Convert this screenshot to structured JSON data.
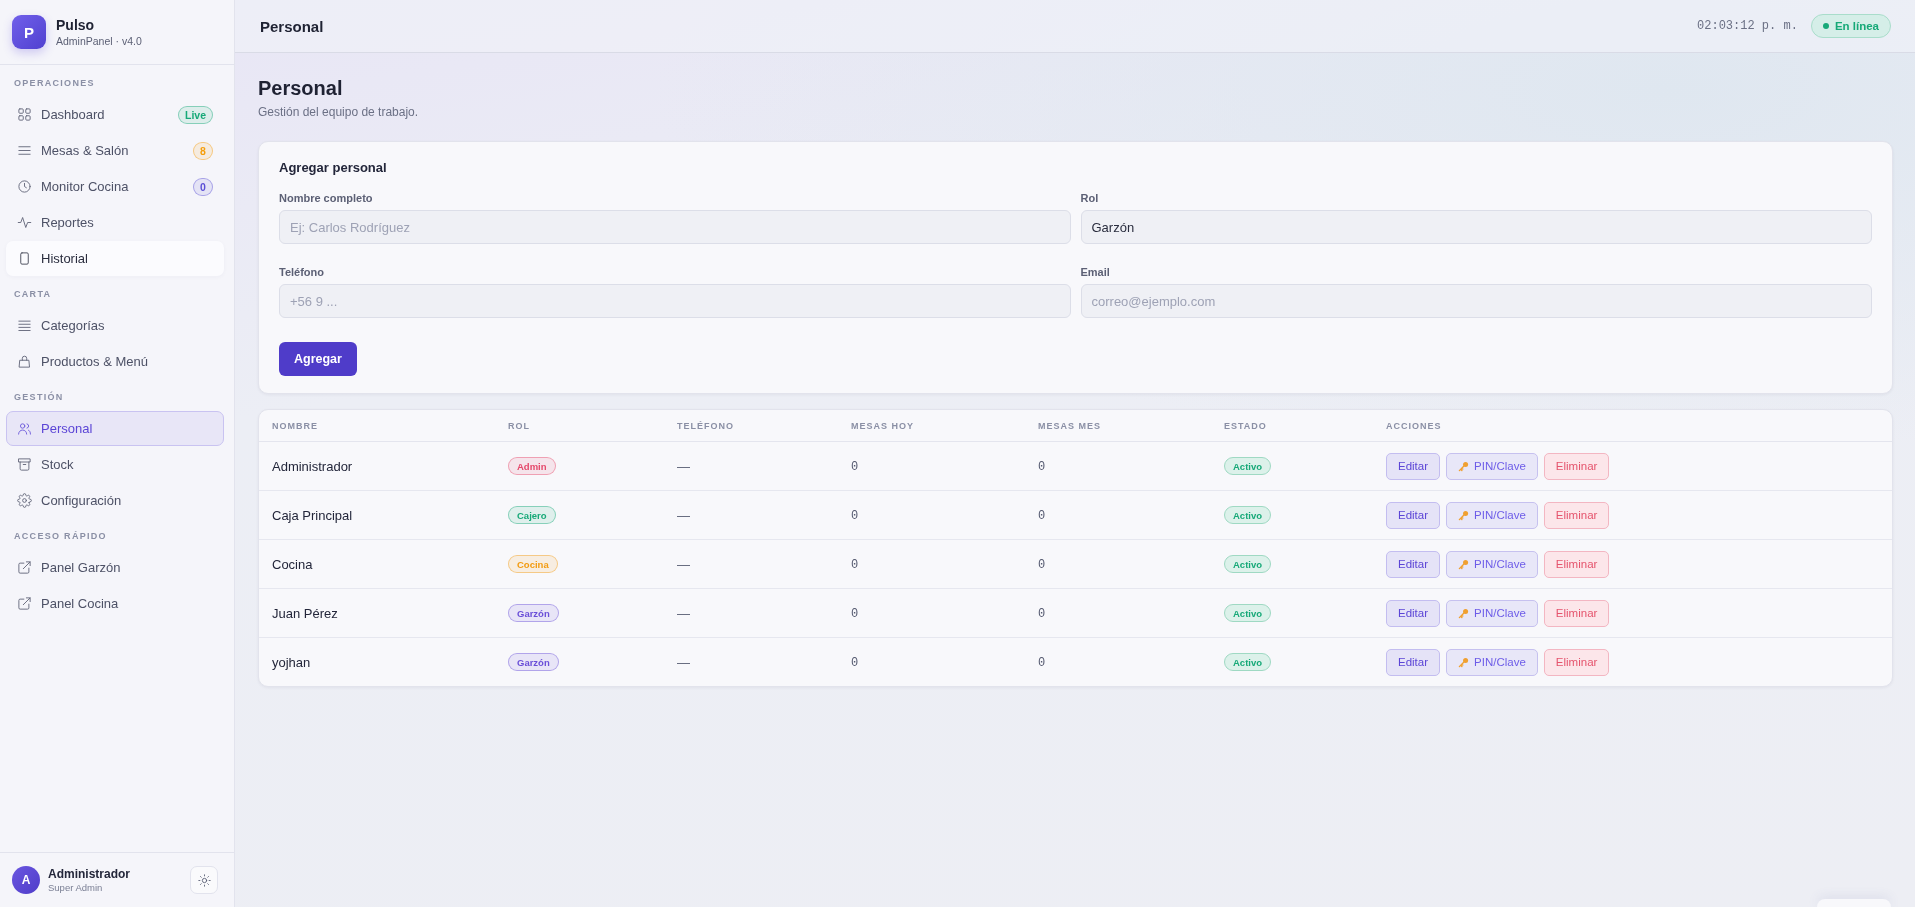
{
  "sidebar": {
    "brand": {
      "logo_letter": "P",
      "name": "Pulso",
      "subtitle": "AdminPanel · v4.0"
    },
    "sections": [
      {
        "title": "OPERACIONES",
        "items": [
          {
            "label": "Dashboard",
            "selected": false,
            "hovered": false,
            "badge": {
              "label": "Live",
              "color": "#17a978"
            }
          },
          {
            "label": "Mesas & Salón",
            "selected": false,
            "hovered": false,
            "badge": {
              "label": "8",
              "color": "#f59e0b"
            }
          },
          {
            "label": "Monitor Cocina",
            "selected": false,
            "hovered": false,
            "badge": {
              "label": "0",
              "color": "#5b4fd6"
            }
          },
          {
            "label": "Reportes",
            "selected": false,
            "hovered": false
          },
          {
            "label": "Historial",
            "selected": false,
            "hovered": true
          }
        ]
      },
      {
        "title": "CARTA",
        "items": [
          {
            "label": "Categorías",
            "selected": false,
            "hovered": false
          },
          {
            "label": "Productos & Menú",
            "selected": false,
            "hovered": false
          }
        ]
      },
      {
        "title": "GESTIÓN",
        "items": [
          {
            "label": "Personal",
            "selected": true,
            "hovered": false
          },
          {
            "label": "Stock",
            "selected": false,
            "hovered": false
          },
          {
            "label": "Configuración",
            "selected": false,
            "hovered": false
          }
        ]
      },
      {
        "title": "ACCESO RÁPIDO",
        "items": [
          {
            "label": "Panel Garzón",
            "selected": false,
            "hovered": false
          },
          {
            "label": "Panel Cocina",
            "selected": false,
            "hovered": false
          }
        ]
      }
    ],
    "user": {
      "initial": "A",
      "name": "Administrador",
      "role": "Super Admin"
    }
  },
  "header": {
    "title": "Personal",
    "clock": "02:03:12 p. m.",
    "status": "En línea"
  },
  "page": {
    "title": "Personal",
    "subtitle": "Gestión del equipo de trabajo."
  },
  "form": {
    "title": "Agregar personal",
    "fields": [
      {
        "label": "Nombre completo",
        "placeholder": "Ej: Carlos Rodríguez"
      },
      {
        "label": "Rol",
        "value": "Garzón"
      },
      {
        "label": "Teléfono",
        "placeholder": "+56 9 ..."
      },
      {
        "label": "Email",
        "placeholder": "correo@ejemplo.com"
      }
    ],
    "submit": "Agregar"
  },
  "table": {
    "columns": [
      "NOMBRE",
      "ROL",
      "TELÉFONO",
      "MESAS HOY",
      "MESAS MES",
      "ESTADO",
      "ACCIONES"
    ],
    "rows": [
      {
        "name": "Administrador",
        "role": {
          "label": "Admin",
          "color": "#e5486b"
        },
        "phone": "—",
        "tables_today": "0",
        "tables_month": "0",
        "status": "Activo",
        "actions": [
          {
            "kind": "edit",
            "label": "Editar"
          },
          {
            "kind": "pin",
            "label": "PIN/Clave"
          },
          {
            "kind": "delete",
            "label": "Eliminar"
          }
        ]
      },
      {
        "name": "Caja Principal",
        "role": {
          "label": "Cajero",
          "color": "#17a978"
        },
        "phone": "—",
        "tables_today": "0",
        "tables_month": "0",
        "status": "Activo",
        "actions": [
          {
            "kind": "edit",
            "label": "Editar"
          },
          {
            "kind": "pin",
            "label": "PIN/Clave"
          },
          {
            "kind": "delete",
            "label": "Eliminar"
          }
        ]
      },
      {
        "name": "Cocina",
        "role": {
          "label": "Cocina",
          "color": "#f29b11"
        },
        "phone": "—",
        "tables_today": "0",
        "tables_month": "0",
        "status": "Activo",
        "actions": [
          {
            "kind": "edit",
            "label": "Editar"
          },
          {
            "kind": "pin",
            "label": "PIN/Clave"
          },
          {
            "kind": "delete",
            "label": "Eliminar"
          }
        ]
      },
      {
        "name": "Juan Pérez",
        "role": {
          "label": "Garzón",
          "color": "#6a4fd8"
        },
        "phone": "—",
        "tables_today": "0",
        "tables_month": "0",
        "status": "Activo",
        "actions": [
          {
            "kind": "edit",
            "label": "Editar"
          },
          {
            "kind": "pin",
            "label": "PIN/Clave"
          },
          {
            "kind": "delete",
            "label": "Eliminar"
          }
        ]
      },
      {
        "name": "yojhan",
        "role": {
          "label": "Garzón",
          "color": "#6a4fd8"
        },
        "phone": "—",
        "tables_today": "0",
        "tables_month": "0",
        "status": "Activo",
        "actions": [
          {
            "kind": "edit",
            "label": "Editar"
          },
          {
            "kind": "pin",
            "label": "PIN/Clave"
          },
          {
            "kind": "delete",
            "label": "Eliminar"
          }
        ]
      }
    ]
  }
}
